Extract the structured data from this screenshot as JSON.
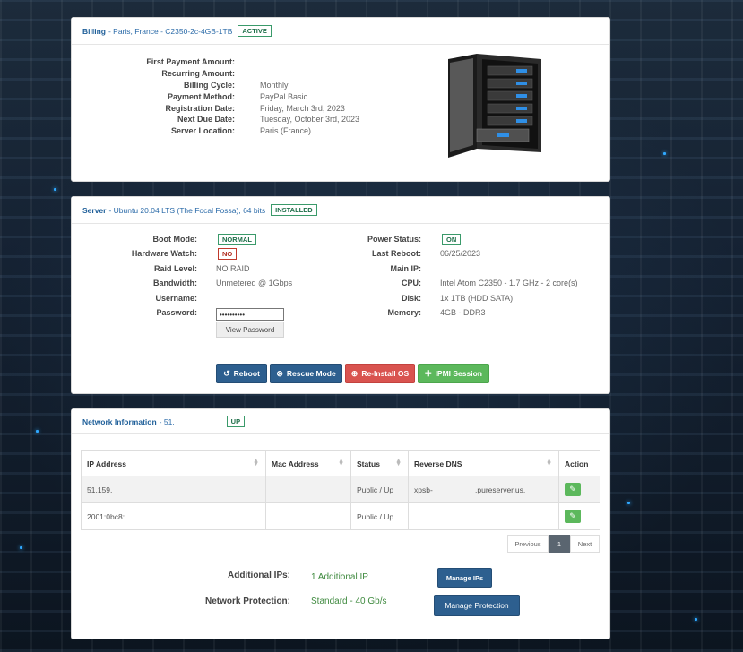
{
  "billing": {
    "label": "Billing",
    "sub": "- Paris, France - C2350-2c-4GB-1TB",
    "status": "ACTIVE",
    "rows": [
      {
        "k": "First Payment Amount:",
        "v": ""
      },
      {
        "k": "Recurring Amount:",
        "v": ""
      },
      {
        "k": "Billing Cycle:",
        "v": "Monthly"
      },
      {
        "k": "Payment Method:",
        "v": "PayPal Basic"
      },
      {
        "k": "Registration Date:",
        "v": "Friday, March 3rd, 2023"
      },
      {
        "k": "Next Due Date:",
        "v": "Tuesday, October 3rd, 2023"
      },
      {
        "k": "Server Location:",
        "v": "Paris (France)"
      }
    ]
  },
  "server": {
    "label": "Server",
    "sub": "- Ubuntu 20.04 LTS (The Focal Fossa), 64 bits",
    "status": "INSTALLED",
    "left": {
      "boot_mode_label": "Boot Mode:",
      "boot_mode": "NORMAL",
      "hw_watch_label": "Hardware Watch:",
      "hw_watch": "NO",
      "raid_label": "Raid Level:",
      "raid": "NO RAID",
      "bandwidth_label": "Bandwidth:",
      "bandwidth": "Unmetered @ 1Gbps",
      "username_label": "Username:",
      "username": "",
      "password_label": "Password:",
      "password": "••••••••••",
      "view_password": "View Password"
    },
    "right": {
      "power_label": "Power Status:",
      "power": "ON",
      "reboot_label": "Last Reboot:",
      "reboot": "06/25/2023",
      "ip_label": "Main IP:",
      "ip": "",
      "cpu_label": "CPU:",
      "cpu": "Intel Atom C2350 - 1.7 GHz - 2 core(s)",
      "disk_label": "Disk:",
      "disk": "1x 1TB (HDD SATA)",
      "memory_label": "Memory:",
      "memory": "4GB - DDR3"
    },
    "buttons": {
      "reboot": "Reboot",
      "rescue": "Rescue Mode",
      "reinstall": "Re-Install OS",
      "ipmi": "IPMI Session"
    }
  },
  "network": {
    "label": "Network Information",
    "sub": "- 51.",
    "status": "UP",
    "columns": [
      "IP Address",
      "Mac Address",
      "Status",
      "Reverse DNS",
      "Action"
    ],
    "rows": [
      {
        "ip": "51.159.",
        "mac": "",
        "status": "Public / Up",
        "rdns": "xpsb-                    .pureserver.us."
      },
      {
        "ip": "2001:0bc8:",
        "mac": "",
        "status": "Public / Up",
        "rdns": ""
      }
    ],
    "pager": {
      "prev": "Previous",
      "page": "1",
      "next": "Next"
    },
    "additional_ips_label": "Additional IPs:",
    "additional_ips": "1 Additional IP",
    "manage_ips": "Manage IPs",
    "protection_label": "Network Protection:",
    "protection": "Standard - 40 Gb/s",
    "manage_protection": "Manage Protection"
  },
  "colors": {
    "accent": "#2d5f8f",
    "success": "#5cb85c",
    "danger": "#d9534f",
    "link": "#1f5f99"
  }
}
